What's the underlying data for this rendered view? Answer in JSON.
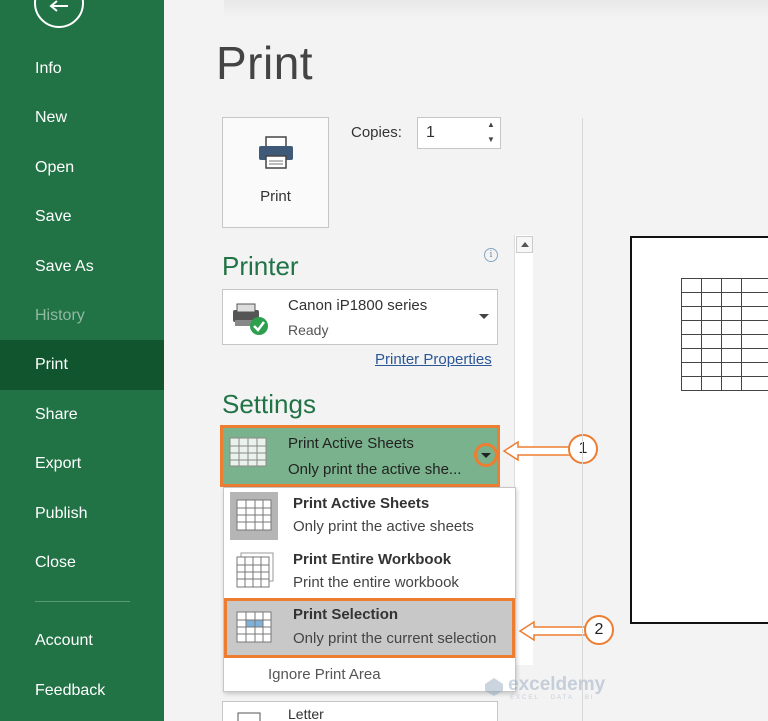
{
  "sidebar": {
    "items": [
      {
        "label": "Info"
      },
      {
        "label": "New"
      },
      {
        "label": "Open"
      },
      {
        "label": "Save"
      },
      {
        "label": "Save As"
      },
      {
        "label": "History"
      },
      {
        "label": "Print"
      },
      {
        "label": "Share"
      },
      {
        "label": "Export"
      },
      {
        "label": "Publish"
      },
      {
        "label": "Close"
      },
      {
        "label": "Account"
      },
      {
        "label": "Feedback"
      }
    ],
    "active": "Print",
    "disabled": "History"
  },
  "page": {
    "title": "Print"
  },
  "print_button": {
    "label": "Print",
    "icon": "printer-icon"
  },
  "copies": {
    "label": "Copies:",
    "value": "1"
  },
  "printer": {
    "section_title": "Printer",
    "name": "Canon iP1800 series",
    "status": "Ready",
    "properties_link": "Printer Properties",
    "info_glyph": "i"
  },
  "settings": {
    "section_title": "Settings",
    "selected": {
      "title": "Print Active Sheets",
      "subtitle": "Only print the active she..."
    },
    "options": [
      {
        "title": "Print Active Sheets",
        "subtitle": "Only print the active sheets"
      },
      {
        "title": "Print Entire Workbook",
        "subtitle": "Print the entire workbook"
      },
      {
        "title": "Print Selection",
        "subtitle": "Only print the current selection"
      }
    ],
    "ignore_print_area": "Ignore Print Area",
    "paper_size": "Letter"
  },
  "callouts": {
    "step1": "1",
    "step2": "2"
  },
  "watermark": {
    "name": "exceldemy",
    "tagline": "EXCEL · DATA · BI"
  },
  "colors": {
    "sidebar": "#217346",
    "accent": "#ed7d31",
    "section_title": "#217346",
    "link": "#2b5797"
  }
}
